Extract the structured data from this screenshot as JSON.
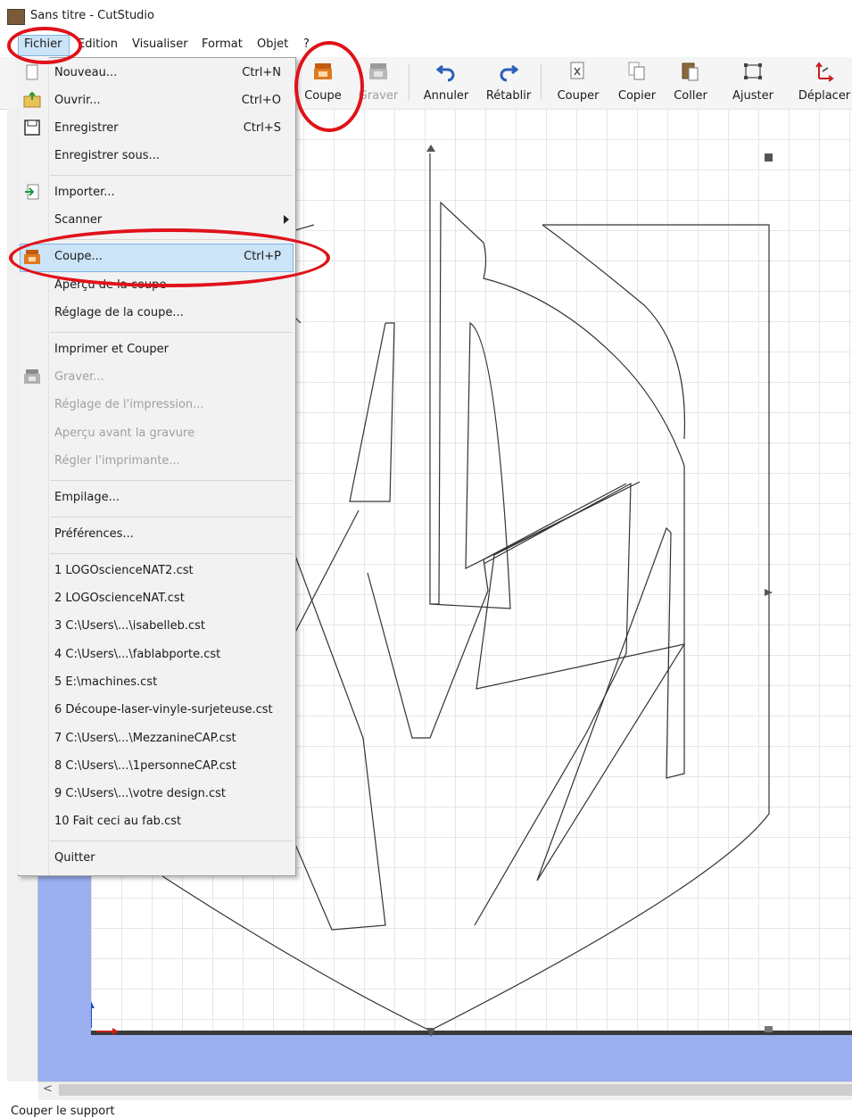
{
  "window": {
    "title": "Sans titre - CutStudio"
  },
  "menubar": {
    "items": [
      "Fichier",
      "Edition",
      "Visualiser",
      "Format",
      "Objet",
      "?"
    ]
  },
  "toolbar": {
    "buttons": [
      {
        "label": "Coupe",
        "icon": "cut-printer-icon",
        "enabled": true
      },
      {
        "label": "Graver",
        "icon": "engrave-printer-icon",
        "enabled": false
      },
      {
        "label": "Annuler",
        "icon": "undo-icon",
        "enabled": true
      },
      {
        "label": "Rétablir",
        "icon": "redo-icon",
        "enabled": true
      },
      {
        "label": "Couper",
        "icon": "cut-icon",
        "enabled": true
      },
      {
        "label": "Copier",
        "icon": "copy-icon",
        "enabled": true
      },
      {
        "label": "Coller",
        "icon": "paste-icon",
        "enabled": true
      },
      {
        "label": "Ajuster",
        "icon": "fit-icon",
        "enabled": true
      },
      {
        "label": "Déplacer",
        "icon": "move-icon",
        "enabled": true
      }
    ]
  },
  "dropdown": {
    "items": [
      {
        "label": "Nouveau...",
        "shortcut": "Ctrl+N",
        "enabled": true,
        "icon": "new-file-icon"
      },
      {
        "label": "Ouvrir...",
        "shortcut": "Ctrl+O",
        "enabled": true,
        "icon": "open-folder-icon"
      },
      {
        "label": "Enregistrer",
        "shortcut": "Ctrl+S",
        "enabled": true,
        "icon": "save-icon"
      },
      {
        "label": "Enregistrer sous...",
        "shortcut": "",
        "enabled": true
      },
      {
        "label": "Importer...",
        "shortcut": "",
        "enabled": true,
        "icon": "import-icon"
      },
      {
        "label": "Scanner",
        "shortcut": "",
        "enabled": true,
        "submenu": true
      },
      {
        "label": "Coupe...",
        "shortcut": "Ctrl+P",
        "enabled": true,
        "highlighted": true,
        "icon": "cut-printer-icon"
      },
      {
        "label": "Aperçu de la coupe",
        "shortcut": "",
        "enabled": true
      },
      {
        "label": "Réglage de la coupe...",
        "shortcut": "",
        "enabled": true
      },
      {
        "label": "Imprimer et Couper",
        "shortcut": "",
        "enabled": true
      },
      {
        "label": "Graver...",
        "shortcut": "",
        "enabled": false,
        "icon": "engrave-printer-icon"
      },
      {
        "label": "Réglage de l'impression...",
        "shortcut": "",
        "enabled": false
      },
      {
        "label": "Aperçu avant la gravure",
        "shortcut": "",
        "enabled": false
      },
      {
        "label": "Régler l'imprimante...",
        "shortcut": "",
        "enabled": false
      },
      {
        "label": "Empilage...",
        "shortcut": "",
        "enabled": true
      },
      {
        "label": "Préférences...",
        "shortcut": "",
        "enabled": true
      },
      {
        "label": "1 LOGOscienceNAT2.cst",
        "shortcut": "",
        "enabled": true
      },
      {
        "label": "2 LOGOscienceNAT.cst",
        "shortcut": "",
        "enabled": true
      },
      {
        "label": "3 C:\\Users\\...\\isabelleb.cst",
        "shortcut": "",
        "enabled": true
      },
      {
        "label": "4 C:\\Users\\...\\fablabporte.cst",
        "shortcut": "",
        "enabled": true
      },
      {
        "label": "5 E:\\machines.cst",
        "shortcut": "",
        "enabled": true
      },
      {
        "label": "6 Découpe-laser-vinyle-surjeteuse.cst",
        "shortcut": "",
        "enabled": true
      },
      {
        "label": "7 C:\\Users\\...\\MezzanineCAP.cst",
        "shortcut": "",
        "enabled": true
      },
      {
        "label": "8 C:\\Users\\...\\1personneCAP.cst",
        "shortcut": "",
        "enabled": true
      },
      {
        "label": "9 C:\\Users\\...\\votre design.cst",
        "shortcut": "",
        "enabled": true
      },
      {
        "label": "10 Fait ceci au fab.cst",
        "shortcut": "",
        "enabled": true
      },
      {
        "label": "Quitter",
        "shortcut": "",
        "enabled": true
      }
    ]
  },
  "statusbar": {
    "text": "Couper le support"
  },
  "colors": {
    "annotation_red": "#e0121a",
    "canvas_margin_blue": "#9aaef0",
    "highlight_blue": "#cce4f7",
    "icon_orange": "#e07a20"
  }
}
